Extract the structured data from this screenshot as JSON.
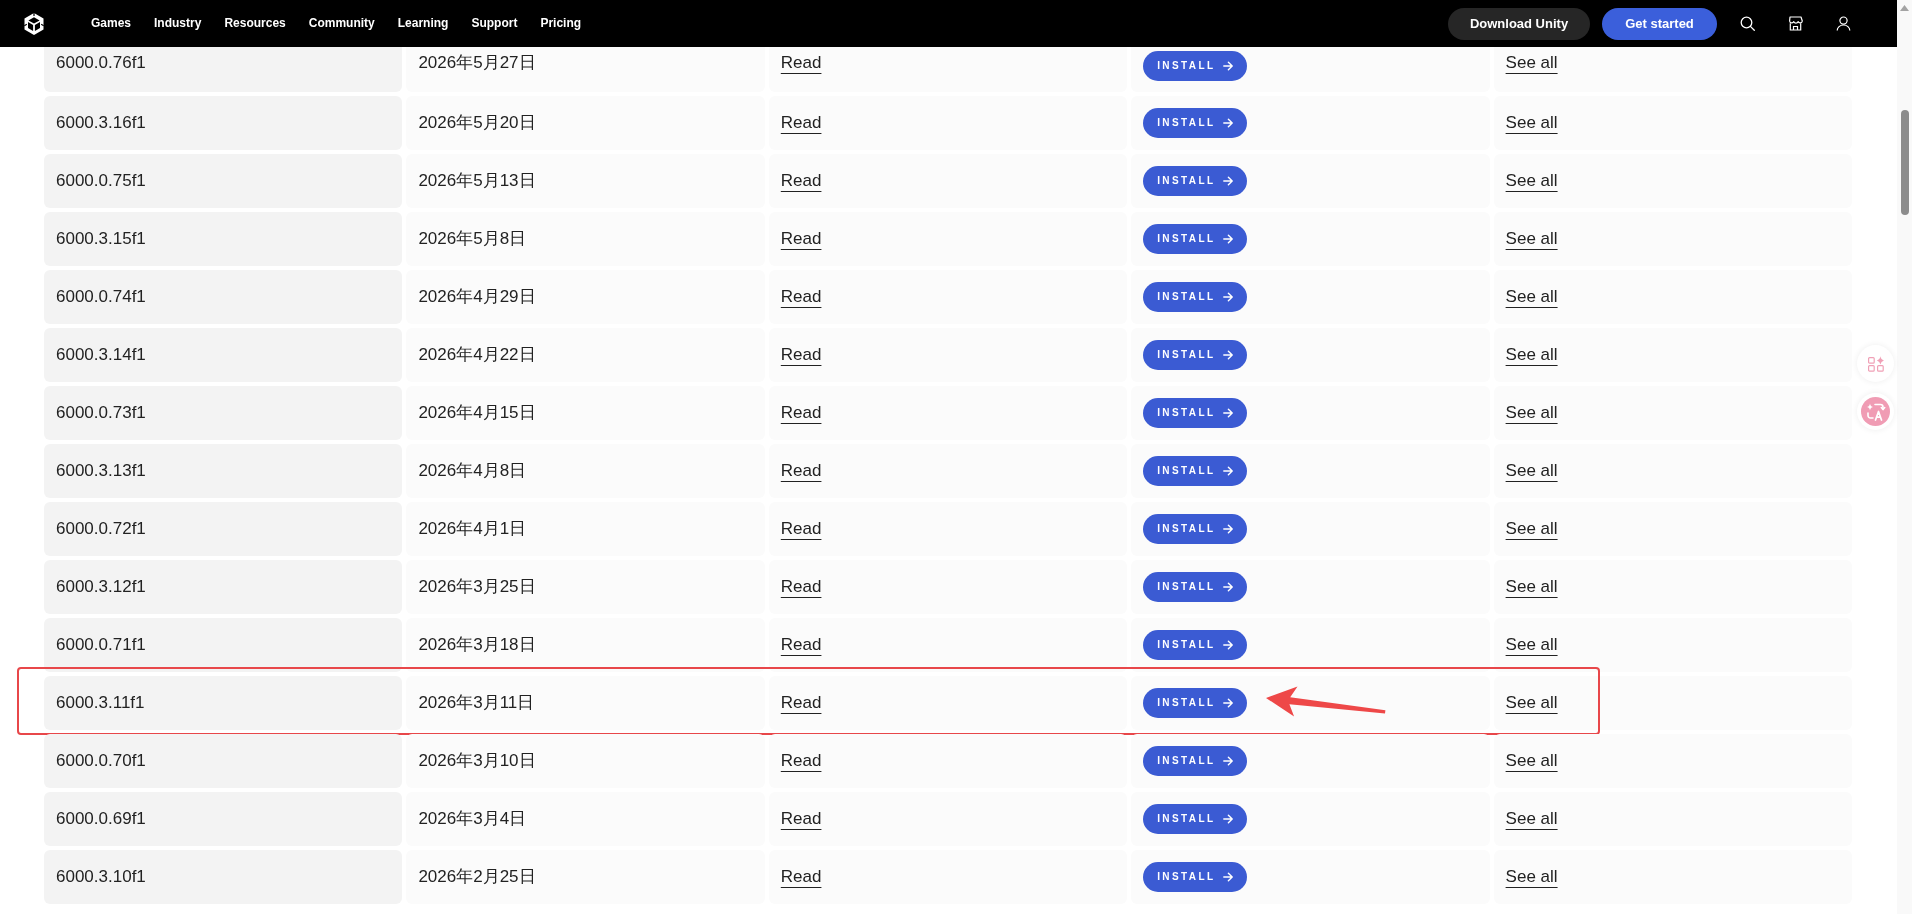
{
  "header": {
    "nav": [
      "Games",
      "Industry",
      "Resources",
      "Community",
      "Learning",
      "Support",
      "Pricing"
    ],
    "buttons": [
      {
        "label": "Download Unity",
        "kind": "secondary"
      },
      {
        "label": "Get started",
        "kind": "primary"
      }
    ]
  },
  "releases": {
    "rows": [
      {
        "version": "6000.0.76f1",
        "release_date": "2026年5月27日",
        "notes_link": "Read",
        "install_label": "INSTALL",
        "modules_link": "See all",
        "highlighted": false
      },
      {
        "version": "6000.3.16f1",
        "release_date": "2026年5月20日",
        "notes_link": "Read",
        "install_label": "INSTALL",
        "modules_link": "See all",
        "highlighted": false
      },
      {
        "version": "6000.0.75f1",
        "release_date": "2026年5月13日",
        "notes_link": "Read",
        "install_label": "INSTALL",
        "modules_link": "See all",
        "highlighted": false
      },
      {
        "version": "6000.3.15f1",
        "release_date": "2026年5月8日",
        "notes_link": "Read",
        "install_label": "INSTALL",
        "modules_link": "See all",
        "highlighted": false
      },
      {
        "version": "6000.0.74f1",
        "release_date": "2026年4月29日",
        "notes_link": "Read",
        "install_label": "INSTALL",
        "modules_link": "See all",
        "highlighted": false
      },
      {
        "version": "6000.3.14f1",
        "release_date": "2026年4月22日",
        "notes_link": "Read",
        "install_label": "INSTALL",
        "modules_link": "See all",
        "highlighted": false
      },
      {
        "version": "6000.0.73f1",
        "release_date": "2026年4月15日",
        "notes_link": "Read",
        "install_label": "INSTALL",
        "modules_link": "See all",
        "highlighted": false
      },
      {
        "version": "6000.3.13f1",
        "release_date": "2026年4月8日",
        "notes_link": "Read",
        "install_label": "INSTALL",
        "modules_link": "See all",
        "highlighted": false
      },
      {
        "version": "6000.0.72f1",
        "release_date": "2026年4月1日",
        "notes_link": "Read",
        "install_label": "INSTALL",
        "modules_link": "See all",
        "highlighted": false
      },
      {
        "version": "6000.3.12f1",
        "release_date": "2026年3月25日",
        "notes_link": "Read",
        "install_label": "INSTALL",
        "modules_link": "See all",
        "highlighted": false
      },
      {
        "version": "6000.0.71f1",
        "release_date": "2026年3月18日",
        "notes_link": "Read",
        "install_label": "INSTALL",
        "modules_link": "See all",
        "highlighted": false
      },
      {
        "version": "6000.3.11f1",
        "release_date": "2026年3月11日",
        "notes_link": "Read",
        "install_label": "INSTALL",
        "modules_link": "See all",
        "highlighted": true
      },
      {
        "version": "6000.0.70f1",
        "release_date": "2026年3月10日",
        "notes_link": "Read",
        "install_label": "INSTALL",
        "modules_link": "See all",
        "highlighted": false
      },
      {
        "version": "6000.0.69f1",
        "release_date": "2026年3月4日",
        "notes_link": "Read",
        "install_label": "INSTALL",
        "modules_link": "See all",
        "highlighted": false
      },
      {
        "version": "6000.3.10f1",
        "release_date": "2026年2月25日",
        "notes_link": "Read",
        "install_label": "INSTALL",
        "modules_link": "See all",
        "highlighted": false
      }
    ]
  }
}
